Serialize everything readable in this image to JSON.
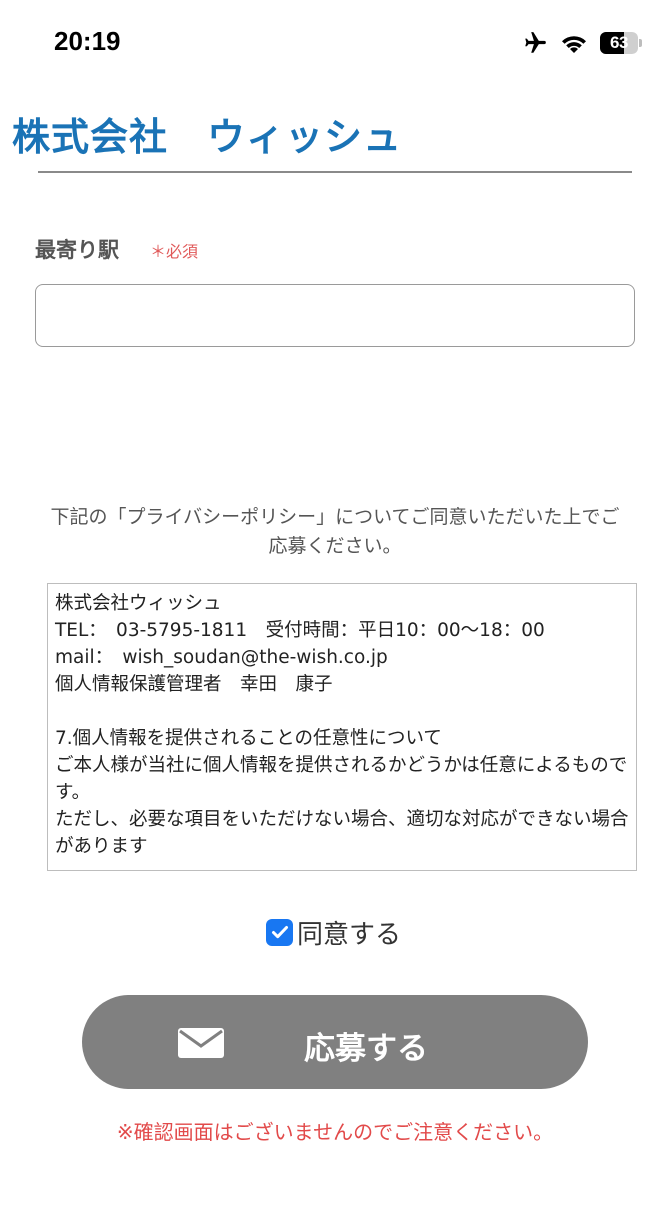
{
  "status_bar": {
    "time": "20:19",
    "icons": [
      "airplane-icon",
      "wifi-icon",
      "battery-icon"
    ],
    "battery_level": "63",
    "battery_fraction": 0.63
  },
  "header": {
    "company_name": "株式会社　ウィッシュ",
    "title_color": "#1a73b6"
  },
  "form": {
    "station_label": "最寄り駅",
    "required_label": "＊必須",
    "station_value": "",
    "station_placeholder": ""
  },
  "privacy": {
    "note": "下記の「プライバシーポリシー」についてご同意いただいた上でご応募ください。",
    "policy_lines": [
      "株式会社ウィッシュ",
      "TEL：　03-5795-1811　受付時間：平日10：00〜18：00",
      "mail：　wish_soudan@the-wish.co.jp",
      "個人情報保護管理者　幸田　康子",
      "",
      "7.個人情報を提供されることの任意性について",
      "ご本人様が当社に個人情報を提供されるかどうかは任意によるものです。",
      "ただし、必要な項目をいただけない場合、適切な対応ができない場合があります"
    ]
  },
  "agree": {
    "label": "同意する",
    "checked": true
  },
  "submit": {
    "label": "応募する",
    "icon": "mail-icon",
    "color": "#808080"
  },
  "notice": "※確認画面はございませんのでご注意ください。",
  "colors": {
    "accent": "#1a73b6",
    "checkbox": "#1877f2",
    "warning": "#e24a4a"
  }
}
